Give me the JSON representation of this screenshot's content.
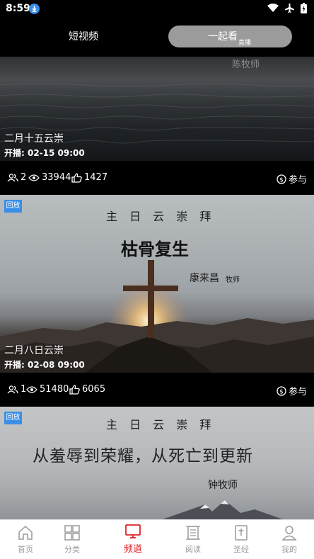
{
  "status_bar": {
    "time": "8:59"
  },
  "tabs": {
    "short_video": "短视频",
    "live_main": "一起看",
    "live_sub": "直播"
  },
  "cards": [
    {
      "watermark": "陈牧师",
      "title": "二月十五云崇",
      "start_label": "开播:",
      "start_time": "02-15 09:00",
      "participants": "2",
      "views": "33944",
      "likes": "1427",
      "join_label": "参与"
    },
    {
      "badge": "回放",
      "header": "主 日 云 崇 拜",
      "sermon_title": "枯骨复生",
      "pastor": "康来昌",
      "pastor_role": "牧师",
      "title": "二月八日云崇",
      "start_label": "开播:",
      "start_time": "02-08 09:00",
      "participants": "1",
      "views": "51480",
      "likes": "6065",
      "join_label": "参与"
    },
    {
      "badge": "回放",
      "header": "主 日 云 崇 拜",
      "sermon_title": "从羞辱到荣耀，从死亡到更新",
      "pastor": "钟牧师"
    }
  ],
  "bottom_nav": {
    "items": [
      {
        "label": "首页",
        "icon": "home-icon"
      },
      {
        "label": "分类",
        "icon": "grid-icon"
      },
      {
        "label": "频道",
        "icon": "tv-icon"
      },
      {
        "label": "阅读",
        "icon": "scroll-icon"
      },
      {
        "label": "圣经",
        "icon": "bible-icon"
      },
      {
        "label": "我的",
        "icon": "user-icon"
      }
    ],
    "active": "频道",
    "active_color": "#e0232b"
  }
}
